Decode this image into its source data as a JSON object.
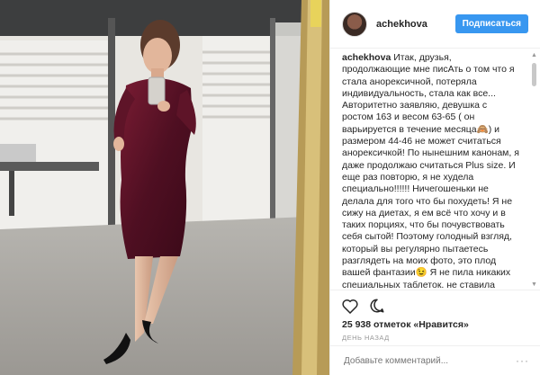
{
  "post": {
    "username": "achekhova",
    "follow_label": "Подписаться"
  },
  "caption": {
    "author": "achekhova",
    "text": "Итак, друзья, продолжающие мне писАть о том что я стала анорексичной, потеряла индивидуальность, стала как все... Авторитетно заявляю, девушка с ростом 163 и весом 63-65 ( он варьируется в течение месяца🙈) и размером 44-46 не может считаться анорексичкой! По нынешним канонам, я даже продолжаю считаться Plus size. И еще раз повторю, я не худела специально!!!!!! Ничегошеньки не делала для того что бы похудеть! Я не сижу на диетах, я ем всё что хочу и в таких порциях, что бы почувствовать себя сытой! Поэтому голодный взгляд, который вы регулярно пытаетесь разглядеть на моих фото, это плод вашей фантазии😉 Я не пила никаких специальных таблеток, не ставила"
  },
  "stats": {
    "likes": "25 938 отметок «Нравится»",
    "date": "ДЕНЬ НАЗАД"
  },
  "comment": {
    "placeholder": "Добавьте комментарий...",
    "more": "···"
  },
  "icons": {
    "like": "heart-icon",
    "comment": "comment-icon"
  }
}
